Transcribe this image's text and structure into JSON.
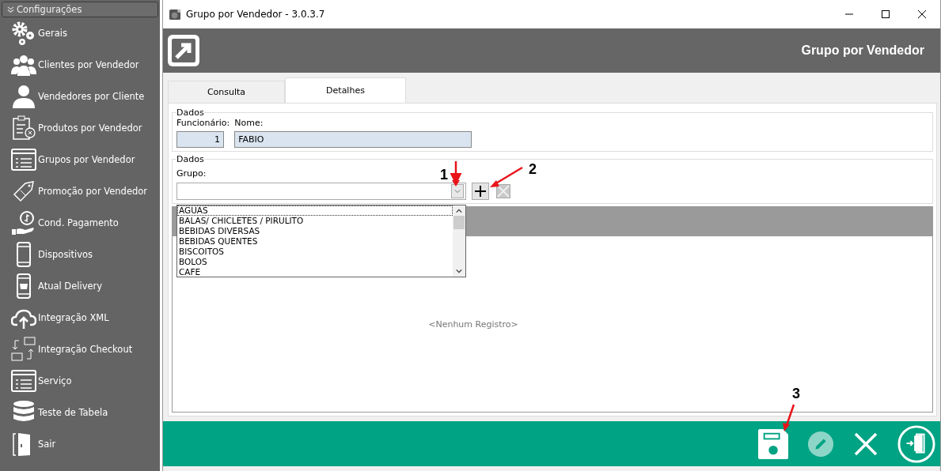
{
  "sidebar": {
    "header": "Configurações",
    "expanded": true,
    "items": [
      {
        "label": "Gerais"
      },
      {
        "label": "Clientes por Vendedor"
      },
      {
        "label": "Vendedores por Cliente"
      },
      {
        "label": "Produtos por Vendedor"
      },
      {
        "label": "Grupos por Vendedor"
      },
      {
        "label": "Promoção por Vendedor"
      },
      {
        "label": "Cond. Pagamento"
      },
      {
        "label": "Dispositivos"
      },
      {
        "label": "Atual Delivery"
      },
      {
        "label": "Integração XML"
      },
      {
        "label": "Integração Checkout"
      },
      {
        "label": "Serviço"
      },
      {
        "label": "Teste de Tabela"
      },
      {
        "label": "Sair"
      }
    ]
  },
  "window": {
    "title": "Grupo por Vendedor - 3.0.3.7"
  },
  "header": {
    "title": "Grupo por Vendedor"
  },
  "tabs": [
    {
      "label": "Consulta",
      "selected": false
    },
    {
      "label": "Detalhes",
      "selected": true
    }
  ],
  "employee_section": {
    "legend": "Dados",
    "employee_label": "Funcionário:",
    "employee_value": "1",
    "name_label": "Nome:",
    "name_value": "FABIO"
  },
  "group_section": {
    "legend": "Dados",
    "group_label": "Grupo:",
    "dropdown_expanded": true,
    "options": [
      {
        "label": "AGUAS",
        "selected": true
      },
      {
        "label": "BALAS/ CHICLETES / PIRULITO",
        "selected": false
      },
      {
        "label": "BEBIDAS DIVERSAS",
        "selected": false
      },
      {
        "label": "BEBIDAS QUENTES",
        "selected": false
      },
      {
        "label": "BISCOITOS",
        "selected": false
      },
      {
        "label": "BOLOS",
        "selected": false
      },
      {
        "label": "CAFE",
        "selected": false
      }
    ],
    "add_disabled": false,
    "remove_disabled": true
  },
  "grid": {
    "empty_text": "<Nenhum Registro>"
  },
  "footer": {
    "buttons": [
      {
        "kind": "save",
        "disabled": false
      },
      {
        "kind": "edit",
        "disabled": true
      },
      {
        "kind": "cancel",
        "disabled": false
      },
      {
        "kind": "exit",
        "disabled": false
      }
    ]
  },
  "annotations": [
    {
      "label": "1"
    },
    {
      "label": "2"
    },
    {
      "label": "3"
    }
  ]
}
